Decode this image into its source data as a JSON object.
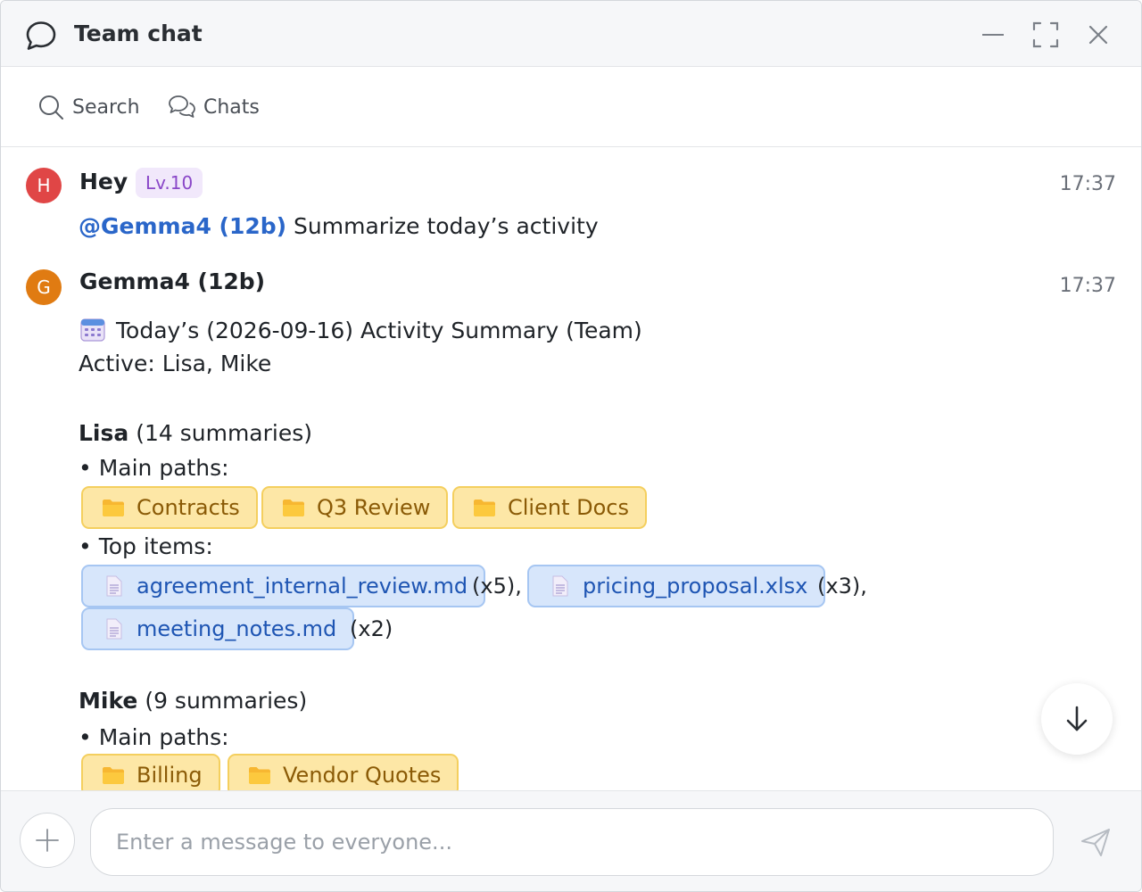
{
  "window": {
    "title": "Team chat"
  },
  "toolbar": {
    "search_label": "Search",
    "chats_label": "Chats"
  },
  "messages": [
    {
      "avatar_letter": "H",
      "avatar_color": "#e04646",
      "sender": "Hey",
      "level": "Lv.10",
      "time": "17:37",
      "mention": "@Gemma4 (12b)",
      "text": "Summarize today’s activity"
    },
    {
      "avatar_letter": "G",
      "avatar_color": "#e07b12",
      "sender": "Gemma4 (12b)",
      "time": "17:37",
      "summary_title": "Today’s (2026-09-16) Activity Summary (Team)",
      "active_line": "Active: Lisa, Mike",
      "users": [
        {
          "name": "Lisa",
          "summary_count": "(14 summaries)",
          "main_paths_label": "• Main paths:",
          "paths": [
            "Contracts",
            "Q3 Review",
            "Client Docs"
          ],
          "top_items_label": "• Top items:",
          "items": [
            {
              "name": "agreement_internal_review.md",
              "count": "(x5),"
            },
            {
              "name": "pricing_proposal.xlsx",
              "count": "(x3),"
            },
            {
              "name": "meeting_notes.md",
              "count": "(x2)"
            }
          ]
        },
        {
          "name": "Mike",
          "summary_count": "(9 summaries)",
          "main_paths_label": "• Main paths:",
          "paths": [
            "Billing",
            "Vendor Quotes"
          ]
        }
      ]
    }
  ],
  "composer": {
    "placeholder": "Enter a message to everyone..."
  },
  "icons": {
    "title": "chat-bubble-icon",
    "minimize": "minimize-icon",
    "maximize": "maximize-icon",
    "close": "close-icon",
    "search": "search-icon",
    "chats": "chats-icon",
    "calendar": "calendar-icon",
    "folder": "folder-icon",
    "file": "file-icon",
    "scroll_down": "arrow-down-icon",
    "add": "plus-icon",
    "send": "send-icon"
  },
  "colors": {
    "mention": "#2a66c9",
    "level_badge_bg": "#f1e8fb",
    "level_badge_text": "#8a47c8",
    "folder_chip_bg": "#fde7a6",
    "file_chip_bg": "#d7e6fb"
  }
}
